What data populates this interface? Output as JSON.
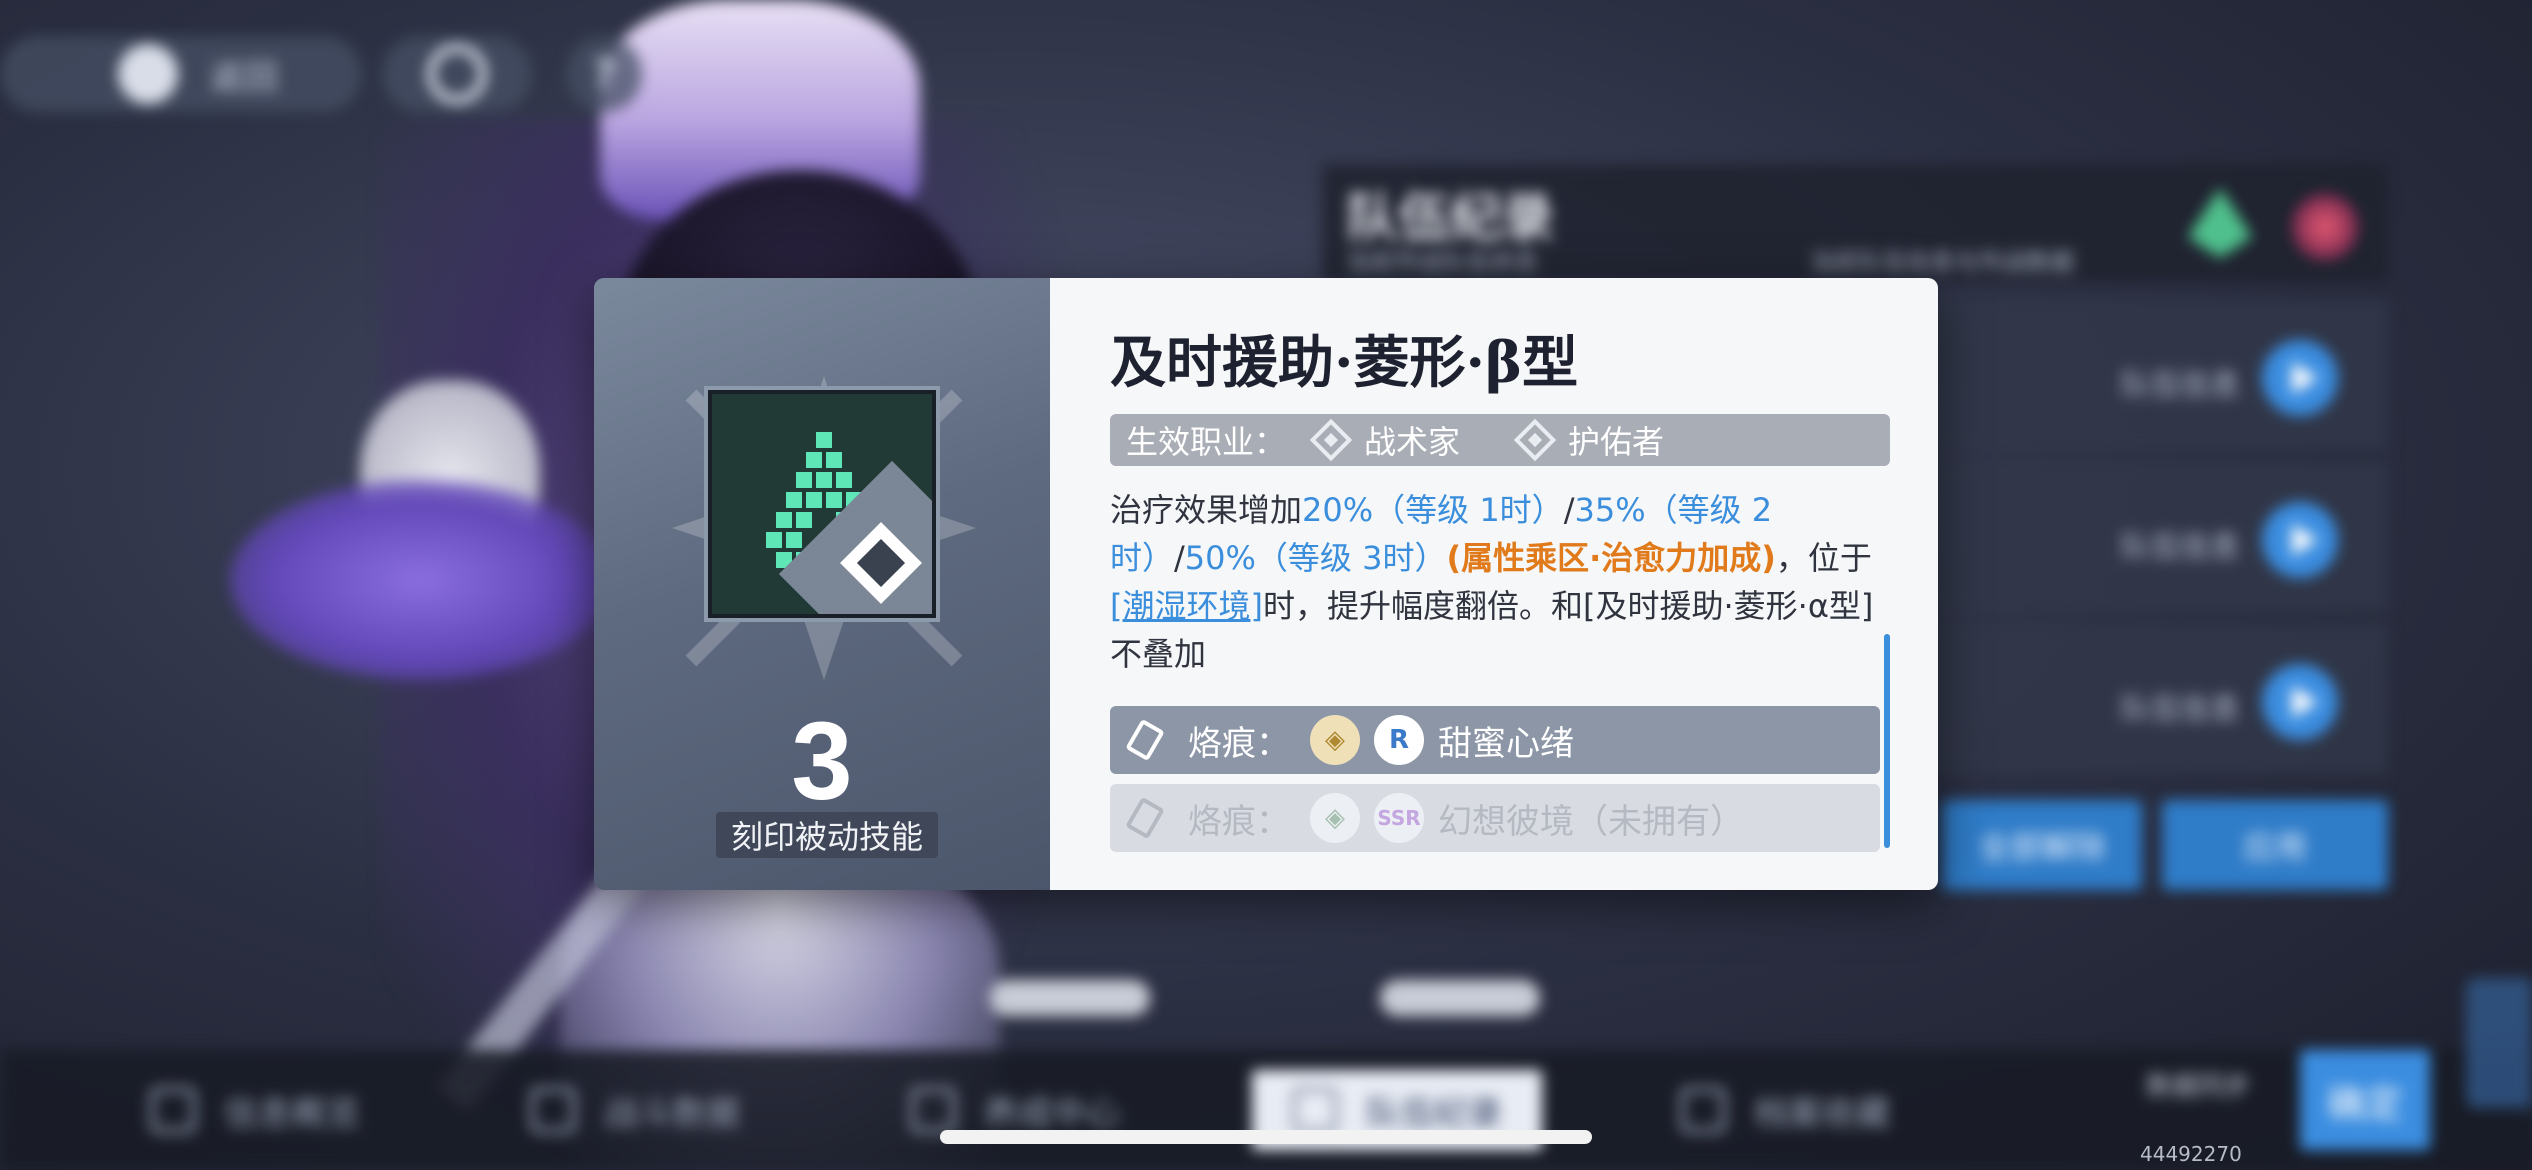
{
  "background": {
    "topbar": {
      "back_label": "返回",
      "help_label": "?"
    },
    "team_panel": {
      "title": "队伍纪录",
      "subtitle_left": "当前作战队伍状态",
      "subtitle_right": "当前队伍信息与作战数据"
    },
    "rows": [
      {
        "label": "队伍信息"
      },
      {
        "label": "队伍信息"
      },
      {
        "label": "队伍信息"
      }
    ],
    "buttons": {
      "clear_all": "全部解除",
      "apply": "应用"
    },
    "bottom_nav": {
      "items": [
        "信息概览",
        "战斗数据",
        "养成中心",
        "队伍纪录",
        "档案收藏"
      ],
      "active_index": 3,
      "meta": "数据同步",
      "confirm": "确定"
    }
  },
  "popup": {
    "skill_name": "及时援助·菱形·β型",
    "cost": "3",
    "skill_type": "刻印被动技能",
    "class_label": "生效职业：",
    "classes": [
      "战术家",
      "护佑者"
    ],
    "description": {
      "t1": "治疗效果增加",
      "h1": "20%（等级 1时）",
      "s1": "/",
      "h2": "35%（等级 2时）",
      "s2": "/",
      "h3": "50%（等级 3时）",
      "o1": "(属性乘区·治愈力加成)",
      "t2": "，位于",
      "link": "[潮湿环境]",
      "t3": "时，提升幅度翻倍。和[及时援助·菱形·α型]不叠加"
    },
    "imprints": [
      {
        "label": "烙痕：",
        "rarity": "R",
        "name": "甜蜜心绪",
        "owned": true
      },
      {
        "label": "烙痕：",
        "rarity": "SSR",
        "name": "幻想彼境（未拥有）",
        "owned": false
      }
    ],
    "icon_names": [
      "skill-drop-icon",
      "diamond-icon",
      "class-icon",
      "imprint-tag-icon"
    ]
  },
  "uid": "44492270",
  "colors": {
    "accent": "#3a8edc",
    "highlight_orange": "#e07a1a",
    "skill_icon_bg": "#223a35",
    "skill_icon_glow": "#5fe6b6"
  }
}
